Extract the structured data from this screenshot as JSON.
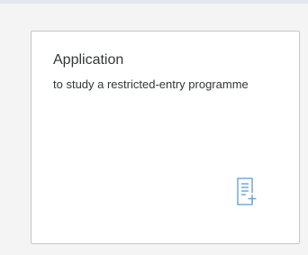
{
  "tile": {
    "title": "Application",
    "subtitle": "to study a restricted-entry programme",
    "icon": "document-add-icon",
    "icon_color": "#5b9bd5"
  }
}
